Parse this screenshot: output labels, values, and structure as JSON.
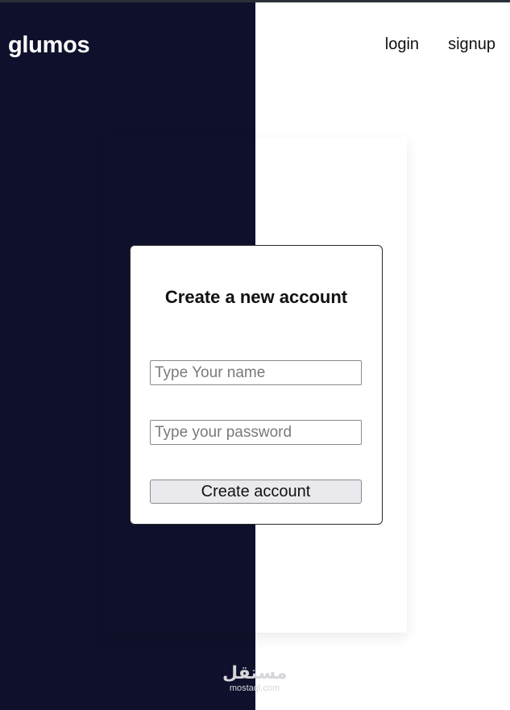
{
  "header": {
    "brand": "glumos",
    "nav": {
      "login": "login",
      "signup": "signup"
    }
  },
  "form": {
    "title": "Create a new account",
    "name_placeholder": "Type Your name",
    "password_placeholder": "Type your password",
    "submit_label": "Create account"
  },
  "watermark": {
    "arabic": "مستقل",
    "latin": "mostaql.com"
  },
  "colors": {
    "panel": "#0f112c",
    "background": "#ffffff"
  }
}
